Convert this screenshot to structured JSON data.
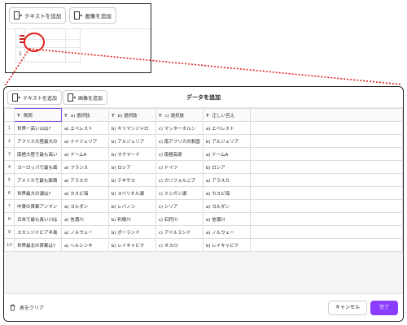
{
  "inset": {
    "add_text": "テキストを追加",
    "add_image": "画像を追加",
    "row_one": "1"
  },
  "modal": {
    "add_text": "テキストを追加",
    "add_image": "画像を追加",
    "title": "データを追加"
  },
  "table": {
    "type_marker": "T",
    "headers": [
      "質問",
      "a) 選択肢",
      "b) 選択肢",
      "c) 選択肢",
      "正しい答え"
    ],
    "rows": [
      [
        "世界一高い山は?",
        "a) エベレスト",
        "b) キリマンジャロ",
        "c) マッターホルン",
        "a) エベレスト"
      ],
      [
        "アフリカ大陸最大の",
        "a) ナイジェリア",
        "b) アルジェリア",
        "c) 南アフリカ共和国",
        "b) アルジェリア"
      ],
      [
        "南極大陸で最も高い",
        "a) ドームA",
        "b) マクマード",
        "c) 南極高原",
        "a) ドームA"
      ],
      [
        "ヨーロッパで最も面",
        "a) フランス",
        "b) ロシア",
        "c) ドイツ",
        "b) ロシア"
      ],
      [
        "アメリカで最も面積",
        "a) アラスカ",
        "b) テキサス",
        "c) カリフォルニア",
        "a) アラスカ"
      ],
      [
        "世界最大の湖は?",
        "a) カスピ海",
        "b) スペリオル湖",
        "c) ミシガン湖",
        "a) カスピ海"
      ],
      [
        "中東の首都アンマン",
        "a) ヨルダン",
        "b) レバノン",
        "c) シリア",
        "a) ヨルダン"
      ],
      [
        "日本で最も長い川は",
        "a) 信濃川",
        "b) 利根川",
        "c) 石狩川",
        "a) 信濃川"
      ],
      [
        "スカンジナビア半島",
        "a) ノルウェー",
        "b) ポーランド",
        "c) アイルランド",
        "a) ノルウェー"
      ],
      [
        "世界最北の首都は?",
        "a) ヘルシンキ",
        "b) レイキャビク",
        "c) オスロ",
        "b) レイキャビク"
      ]
    ]
  },
  "footer": {
    "clear_table": "表をクリア",
    "cancel": "キャンセル",
    "done": "完了"
  },
  "colors": {
    "accent": "#8b3dff",
    "highlight": "#e0201b",
    "active_border": "#7b4fd9"
  },
  "icons": {
    "add_text": "add-text-icon",
    "add_image": "add-image-icon",
    "clear": "trash-icon"
  }
}
